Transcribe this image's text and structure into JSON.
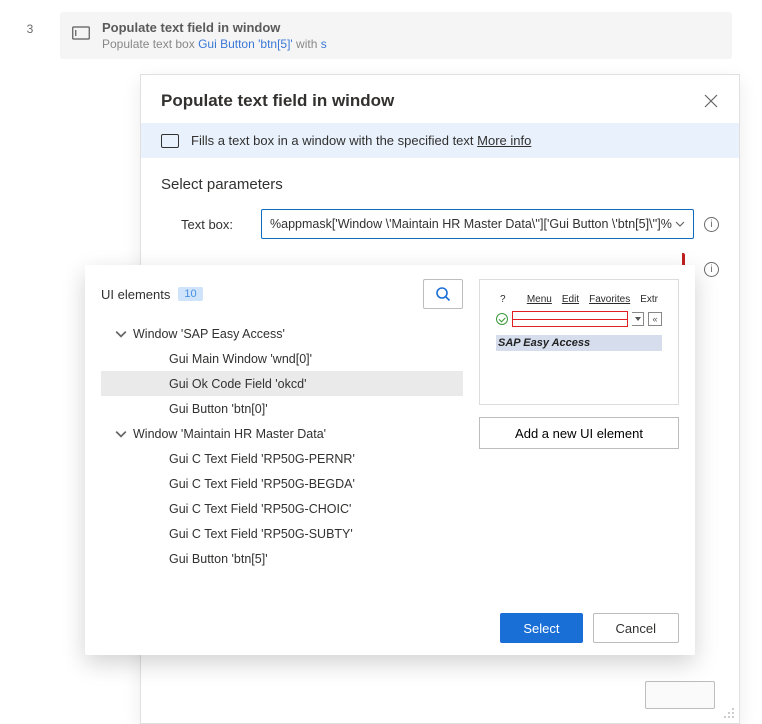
{
  "step": {
    "number": "3",
    "title": "Populate text field in window",
    "sub_prefix": "Populate text box ",
    "sub_link": "Gui Button 'btn[5]'",
    "sub_middle": " with ",
    "sub_link2": "s"
  },
  "dialog": {
    "title": "Populate text field in window",
    "banner_text": "Fills a text box in a window with the specified text ",
    "banner_more": "More info",
    "section": "Select parameters",
    "param_label": "Text box:",
    "textbox_value": "%appmask['Window \\'Maintain HR Master Data\\'']['Gui Button \\'btn[5]\\'']%"
  },
  "picker": {
    "title": "UI elements",
    "count": "10",
    "add_label": "Add a new UI element",
    "select_label": "Select",
    "cancel_label": "Cancel",
    "preview": {
      "menu": [
        "Menu",
        "Edit",
        "Favorites",
        "Extr"
      ],
      "preview_marker": "?",
      "sap_title": "SAP Easy Access",
      "sq_label": "«"
    },
    "tree": [
      {
        "label": "Window 'SAP Easy Access'",
        "depth": 0,
        "expandable": true
      },
      {
        "label": "Gui Main Window 'wnd[0]'",
        "depth": 1,
        "expandable": false
      },
      {
        "label": "Gui Ok Code Field 'okcd'",
        "depth": 1,
        "expandable": false,
        "selected": true
      },
      {
        "label": "Gui Button 'btn[0]'",
        "depth": 1,
        "expandable": false
      },
      {
        "label": "Window 'Maintain HR Master Data'",
        "depth": 0,
        "expandable": true
      },
      {
        "label": "Gui C Text Field 'RP50G-PERNR'",
        "depth": 1,
        "expandable": false
      },
      {
        "label": "Gui C Text Field 'RP50G-BEGDA'",
        "depth": 1,
        "expandable": false
      },
      {
        "label": "Gui C Text Field 'RP50G-CHOIC'",
        "depth": 1,
        "expandable": false
      },
      {
        "label": "Gui C Text Field 'RP50G-SUBTY'",
        "depth": 1,
        "expandable": false
      },
      {
        "label": "Gui Button 'btn[5]'",
        "depth": 1,
        "expandable": false
      }
    ]
  }
}
